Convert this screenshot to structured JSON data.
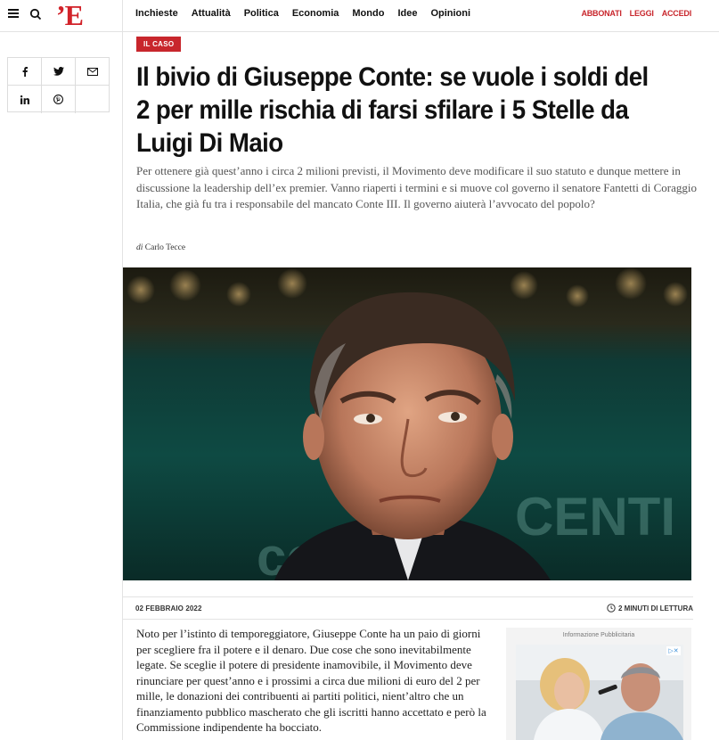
{
  "header": {
    "logo": "’E",
    "nav": [
      "Inchieste",
      "Attualità",
      "Politica",
      "Economia",
      "Mondo",
      "Idee",
      "Opinioni"
    ],
    "right_links": [
      "ABBONATI",
      "LEGGI",
      "ACCEDI"
    ]
  },
  "share": [
    "facebook-icon",
    "twitter-icon",
    "email-icon",
    "linkedin-icon",
    "pinterest-icon"
  ],
  "article": {
    "tag": "IL CASO",
    "title": "Il bivio di Giuseppe Conte: se vuole i soldi del 2 per mille rischia di farsi sfilare i 5 Stelle da Luigi Di Maio",
    "dek": "Per ottenere già quest’anno i circa 2 milioni previsti, il Movimento deve modificare il suo statuto e dunque mettere in discussione la leadership dell’ex premier. Vanno riaperti i termini e si muove col governo il senatore Fantetti di Coraggio Italia, che già fu tra i responsabile del mancato Conte III. Il governo aiuterà l’avvocato del popolo?",
    "byline_prefix": "di",
    "author": "Carlo Tecce",
    "date": "02 FEBBRAIO 2022",
    "read_time": "2 MINUTI DI LETTURA",
    "body": "Noto per l’istinto di temporeggiatore, Giuseppe Conte ha un paio di giorni per scegliere fra il potere e il denaro. Due cose che sono inevitabilmente legate. Se sceglie il potere di presidente inamovibile, il Movimento deve rinunciare per quest’anno e i prossimi a circa due milioni di euro del 2 per mille, le donazioni dei contribuenti ai partiti politici, nient’altro che un finanziamento pubblico mascherato che gli iscritti hanno accettato e però la Commissione indipendente ha bocciato."
  },
  "ad": {
    "label": "Informazione Pubblicitaria"
  },
  "colors": {
    "brand": "#d2232a",
    "tag": "#c8262c"
  }
}
